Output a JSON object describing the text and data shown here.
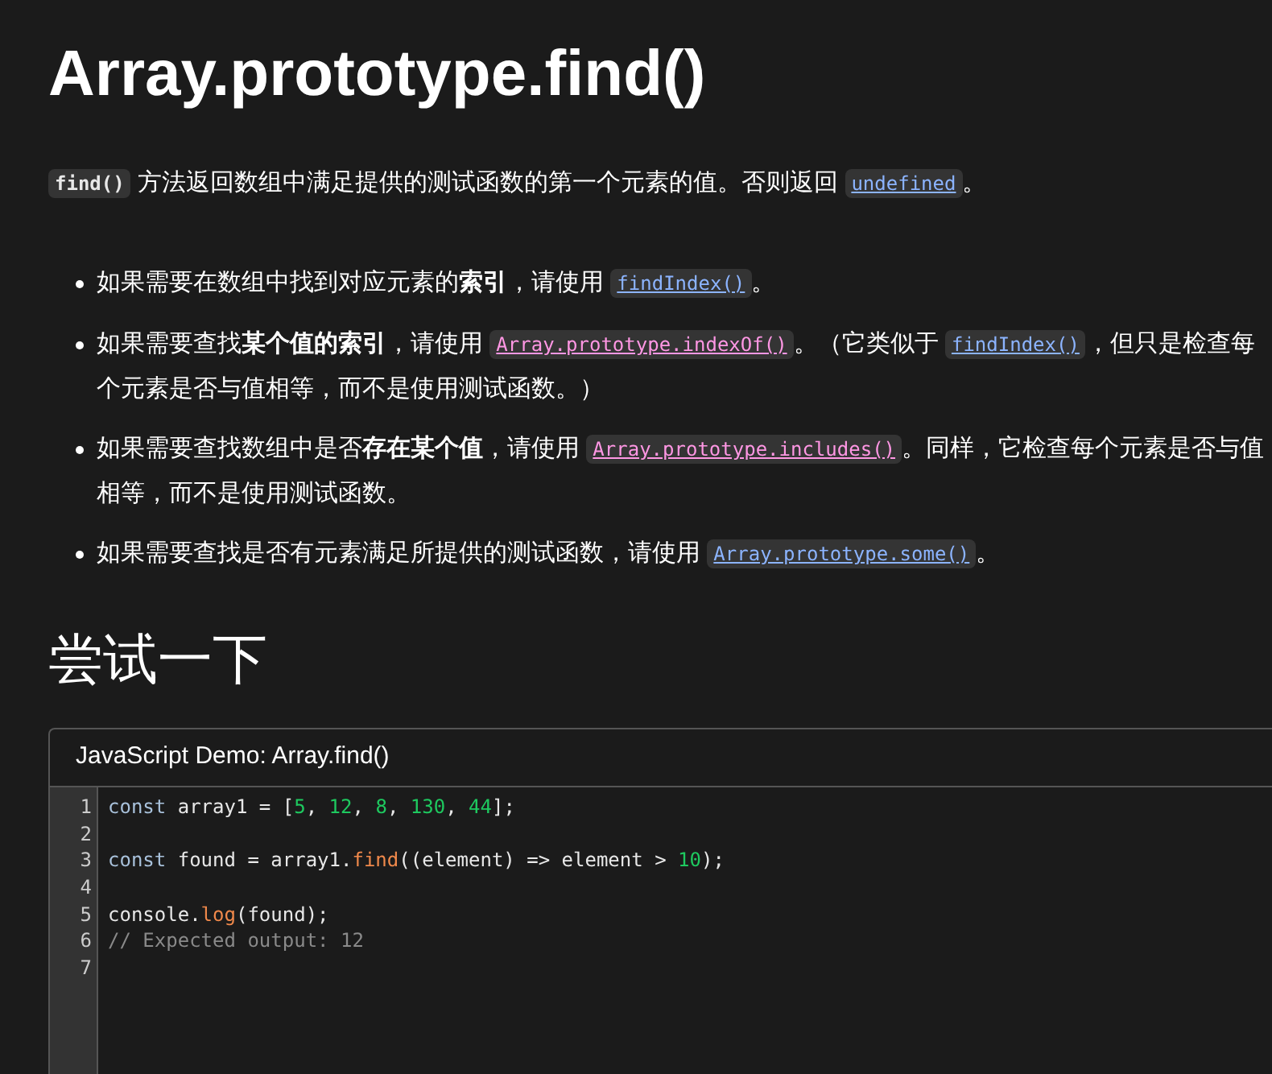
{
  "title": "Array.prototype.find()",
  "intro": [
    {
      "kind": "code",
      "text": "find()"
    },
    {
      "kind": "text",
      "text": " 方法返回数组中满足提供的测试函数的第一个元素的值。否则返回 "
    },
    {
      "kind": "link",
      "text": "undefined",
      "color": "#8cb4ff"
    },
    {
      "kind": "text",
      "text": "。"
    }
  ],
  "bullets": [
    [
      {
        "kind": "text",
        "text": "如果需要在数组中找到对应元素的**索引**，请使用 "
      },
      {
        "kind": "link",
        "text": "findIndex()",
        "color": "#8cb4ff"
      },
      {
        "kind": "text",
        "text": "。"
      }
    ],
    [
      {
        "kind": "text",
        "text": "如果需要查找**某个值的索引**，请使用 "
      },
      {
        "kind": "link",
        "text": "Array.prototype.indexOf()",
        "color": "#ff97e4"
      },
      {
        "kind": "text",
        "text": "。（它类似于 "
      },
      {
        "kind": "link",
        "text": "findIndex()",
        "color": "#8cb4ff"
      },
      {
        "kind": "text",
        "text": "，但只是检查每个元素是否与值相等，而不是使用测试函数。）"
      }
    ],
    [
      {
        "kind": "text",
        "text": "如果需要查找数组中是否**存在某个值**，请使用 "
      },
      {
        "kind": "link",
        "text": "Array.prototype.includes()",
        "color": "#ff97e4"
      },
      {
        "kind": "text",
        "text": "。同样，它检查每个元素是否与值相等，而不是使用测试函数。"
      }
    ],
    [
      {
        "kind": "text",
        "text": "如果需要查找是否有元素满足所提供的测试函数，请使用 "
      },
      {
        "kind": "link",
        "text": "Array.prototype.some()",
        "color": "#8cb4ff"
      },
      {
        "kind": "text",
        "text": "。"
      }
    ]
  ],
  "section_heading": "尝试一下",
  "demo": {
    "title": "JavaScript Demo: Array.find()",
    "lines": [
      {
        "number": "1",
        "tokens": [
          {
            "kind": "keyword",
            "text": "const "
          },
          {
            "kind": "plain",
            "text": "array1 = ["
          },
          {
            "kind": "number",
            "text": "5"
          },
          {
            "kind": "plain",
            "text": ", "
          },
          {
            "kind": "number",
            "text": "12"
          },
          {
            "kind": "plain",
            "text": ", "
          },
          {
            "kind": "number",
            "text": "8"
          },
          {
            "kind": "plain",
            "text": ", "
          },
          {
            "kind": "number",
            "text": "130"
          },
          {
            "kind": "plain",
            "text": ", "
          },
          {
            "kind": "number",
            "text": "44"
          },
          {
            "kind": "plain",
            "text": "];"
          }
        ]
      },
      {
        "number": "2"
      },
      {
        "number": "3",
        "tokens": [
          {
            "kind": "keyword",
            "text": "const "
          },
          {
            "kind": "plain",
            "text": "found = array1."
          },
          {
            "kind": "function",
            "text": "find"
          },
          {
            "kind": "plain",
            "text": "((element) => element > "
          },
          {
            "kind": "number",
            "text": "10"
          },
          {
            "kind": "plain",
            "text": ");"
          }
        ]
      },
      {
        "number": "4"
      },
      {
        "number": "5",
        "tokens": [
          {
            "kind": "plain",
            "text": "console."
          },
          {
            "kind": "function",
            "text": "log"
          },
          {
            "kind": "plain",
            "text": "(found);"
          }
        ]
      },
      {
        "number": "6",
        "tokens": [
          {
            "kind": "comment",
            "text": "// Expected output: 12"
          }
        ]
      },
      {
        "number": "7"
      }
    ]
  }
}
